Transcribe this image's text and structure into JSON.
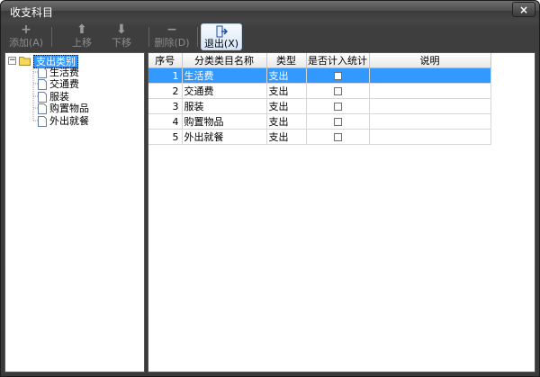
{
  "window": {
    "title": "收支科目",
    "close_label": "×"
  },
  "toolbar": {
    "add": {
      "label": "添加(A)",
      "icon": "plus-icon"
    },
    "up": {
      "label": "上移",
      "icon": "arrow-up-icon"
    },
    "down": {
      "label": "下移",
      "icon": "arrow-down-icon"
    },
    "delete": {
      "label": "删除(D)",
      "icon": "minus-icon"
    },
    "exit": {
      "label": "退出(X)",
      "icon": "exit-icon"
    }
  },
  "tree": {
    "root": {
      "label": "支出类别",
      "expander": "−"
    },
    "items": [
      {
        "label": "生活费"
      },
      {
        "label": "交通费"
      },
      {
        "label": "服装"
      },
      {
        "label": "购置物品"
      },
      {
        "label": "外出就餐"
      }
    ]
  },
  "grid": {
    "columns": [
      "序号",
      "分类类目名称",
      "类型",
      "是否计入统计",
      "说明"
    ],
    "rows": [
      {
        "no": "1",
        "name": "生活费",
        "type": "支出",
        "stat": false,
        "note": ""
      },
      {
        "no": "2",
        "name": "交通费",
        "type": "支出",
        "stat": false,
        "note": ""
      },
      {
        "no": "3",
        "name": "服装",
        "type": "支出",
        "stat": false,
        "note": ""
      },
      {
        "no": "4",
        "name": "购置物品",
        "type": "支出",
        "stat": false,
        "note": ""
      },
      {
        "no": "5",
        "name": "外出就餐",
        "type": "支出",
        "stat": false,
        "note": ""
      }
    ],
    "selected_row": 1
  },
  "colors": {
    "selection": "#3399ff",
    "frame": "#3a3a3a"
  }
}
